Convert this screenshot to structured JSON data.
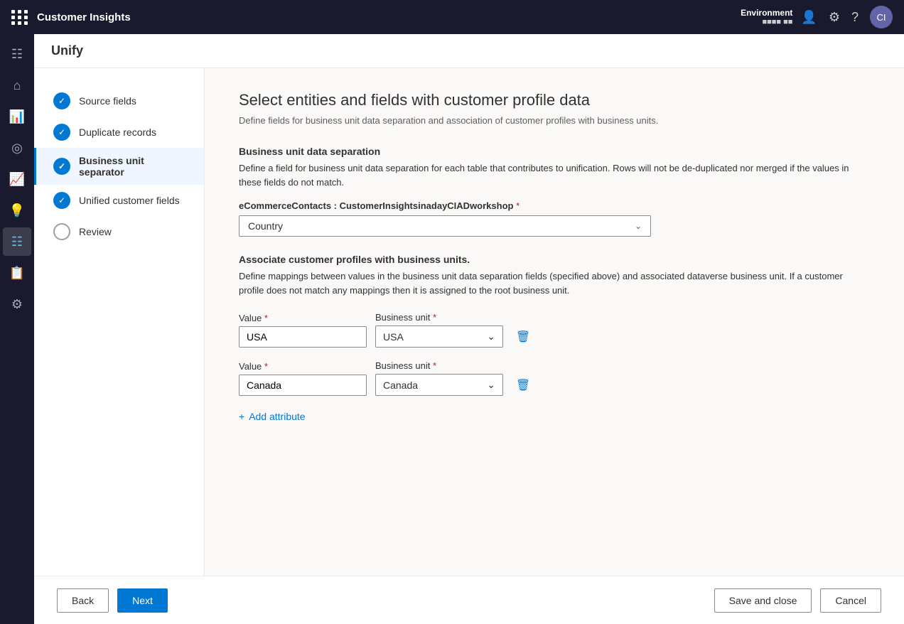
{
  "topNav": {
    "appName": "Customer Insights",
    "environment": {
      "label": "Environment",
      "value": "■■■■ ■■"
    }
  },
  "subHeader": {
    "title": "Unify"
  },
  "steps": [
    {
      "id": "source-fields",
      "label": "Source fields",
      "status": "completed"
    },
    {
      "id": "duplicate-records",
      "label": "Duplicate records",
      "status": "completed"
    },
    {
      "id": "business-unit-separator",
      "label": "Business unit separator",
      "status": "active"
    },
    {
      "id": "unified-customer-fields",
      "label": "Unified customer fields",
      "status": "completed"
    },
    {
      "id": "review",
      "label": "Review",
      "status": "empty"
    }
  ],
  "page": {
    "heading": "Select entities and fields with customer profile data",
    "subtitle": "Define fields for business unit data separation and association of customer profiles with business units.",
    "businessUnitSeparation": {
      "title": "Business unit data separation",
      "description": "Define a field for business unit data separation for each table that contributes to unification. Rows will not be de-duplicated nor merged if the values in these fields do not match.",
      "entityLabel": "eCommerceContacts : CustomerInsightsinadayCIADworkshop",
      "required": true,
      "selectedValue": "Country"
    },
    "associateProfiles": {
      "title": "Associate customer profiles with business units.",
      "description": "Define mappings between values in the business unit data separation fields (specified above) and associated dataverse business unit. If a customer profile does not match any mappings then it is assigned to the root business unit.",
      "rows": [
        {
          "valueLabel": "Value",
          "valueRequired": true,
          "valueInput": "USA",
          "businessUnitLabel": "Business unit",
          "businessUnitRequired": true,
          "businessUnitInput": "USA"
        },
        {
          "valueLabel": "Value",
          "valueRequired": true,
          "valueInput": "Canada",
          "businessUnitLabel": "Business unit",
          "businessUnitRequired": true,
          "businessUnitInput": "Canada"
        }
      ],
      "addAttributeLabel": "Add attribute"
    }
  },
  "footer": {
    "backLabel": "Back",
    "nextLabel": "Next",
    "saveAndCloseLabel": "Save and close",
    "cancelLabel": "Cancel"
  },
  "icons": {
    "gridMenu": "⊞",
    "home": "⌂",
    "analytics": "📊",
    "target": "◎",
    "chart": "📈",
    "bulb": "💡",
    "data": "🗄",
    "report": "📋",
    "settings": "⚙",
    "chevronDown": "⌄",
    "plus": "+",
    "trash": "🗑",
    "person": "👤",
    "gear": "⚙",
    "help": "?",
    "checkmark": "✓"
  }
}
